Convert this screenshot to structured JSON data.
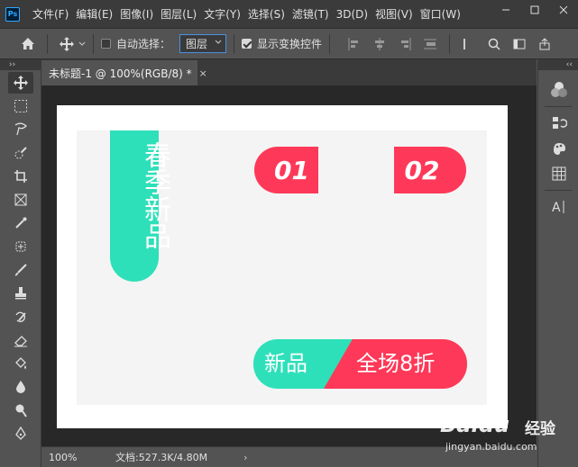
{
  "menubar": {
    "items": [
      "文件(F)",
      "编辑(E)",
      "图像(I)",
      "图层(L)",
      "文字(Y)",
      "选择(S)",
      "滤镜(T)",
      "3D(D)",
      "视图(V)",
      "窗口(W)"
    ],
    "logo_text": "Ps"
  },
  "options": {
    "auto_select_label": "自动选择：",
    "layer_select_value": "图层",
    "show_transform_label": "显示变换控件"
  },
  "tab": {
    "title": "未标题-1 @ 100%(RGB/8) *",
    "close": "×"
  },
  "canvas": {
    "vertical_text": "春季新品",
    "pill_01": "01",
    "pill_02": "02",
    "combo_left": "新品",
    "combo_right": "全场8折",
    "colors": {
      "teal": "#2ee0b9",
      "red": "#fe3858"
    }
  },
  "status": {
    "zoom": "100%",
    "doc_info": "文档:527.3K/4.80M",
    "arrow": "›"
  },
  "watermark": {
    "brand": "Baidu",
    "cn": "经验",
    "url": "jingyan.baidu.com"
  }
}
